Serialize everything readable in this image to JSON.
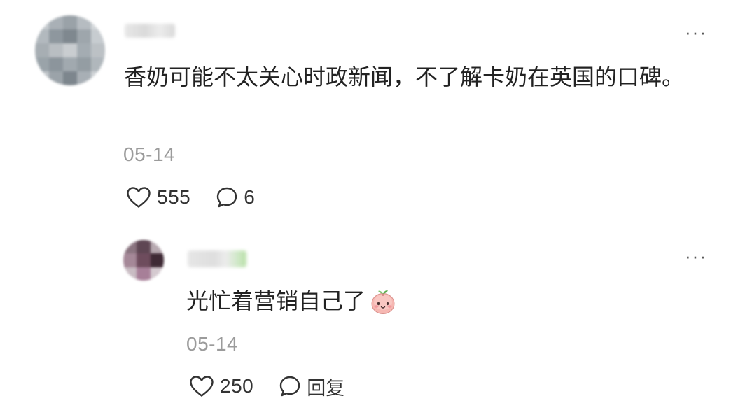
{
  "comment": {
    "text": "香奶可能不太关心时政新闻，不了解卡奶在英国的口碑。",
    "date": "05-14",
    "likes": "555",
    "replies_count": "6",
    "icons": {
      "like": "heart-outline-icon",
      "reply": "speech-bubble-icon",
      "more": "ellipsis-icon"
    }
  },
  "reply": {
    "text": "光忙着营销自己了",
    "emoji": "peach-face-emoji",
    "date": "05-14",
    "likes": "250",
    "reply_label": "回复",
    "icons": {
      "like": "heart-outline-icon",
      "reply": "speech-bubble-icon",
      "more": "ellipsis-icon"
    }
  },
  "colors": {
    "text": "#222222",
    "meta": "#9b9b9b",
    "icon": "#333333",
    "background": "#ffffff"
  }
}
